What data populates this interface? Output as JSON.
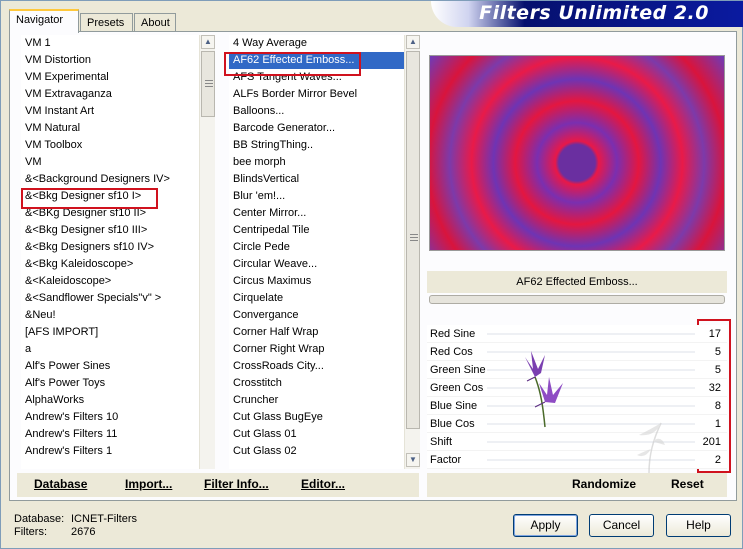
{
  "window": {
    "banner_title": "Filters Unlimited 2.0"
  },
  "tabs": [
    {
      "label": "Navigator"
    },
    {
      "label": "Presets"
    },
    {
      "label": "About"
    }
  ],
  "categories": [
    "VM 1",
    "VM Distortion",
    "VM Experimental",
    "VM Extravaganza",
    "VM Instant Art",
    "VM Natural",
    "VM Toolbox",
    "VM",
    "&<Background Designers IV>",
    "&<Bkg Designer sf10 I>",
    "&<BKg Designer sf10 II>",
    "&<Bkg Designer sf10 III>",
    "&<Bkg Designers sf10 IV>",
    "&<Bkg Kaleidoscope>",
    "&<Kaleidoscope>",
    "&<Sandflower Specials\"v\" >",
    "&Neu!",
    "[AFS IMPORT]",
    "a",
    "Alf's Power Sines",
    "Alf's Power Toys",
    "AlphaWorks",
    "Andrew's Filters 10",
    "Andrew's Filters 11",
    "Andrew's Filters 1"
  ],
  "filters": [
    "4 Way Average",
    "AF62 Effected Emboss...",
    "AFS Tangent Waves...",
    "ALFs Border Mirror Bevel",
    "Balloons...",
    "Barcode Generator...",
    "BB StringThing..",
    "bee morph",
    "BlindsVertical",
    "Blur 'em!...",
    "Center Mirror...",
    "Centripedal Tile",
    "Circle Pede",
    "Circular Weave...",
    "Circus Maximus",
    "Cirquelate",
    "Convergance",
    "Corner Half Wrap",
    "Corner Right Wrap",
    "CrossRoads City...",
    "Crosstitch",
    "Cruncher",
    "Cut Glass  BugEye",
    "Cut Glass 01",
    "Cut Glass 02"
  ],
  "selected_filter_display": "AF62 Effected Emboss...",
  "params": [
    {
      "label": "Red Sine",
      "value": "17"
    },
    {
      "label": "Red Cos",
      "value": "5"
    },
    {
      "label": "Green Sine",
      "value": "5"
    },
    {
      "label": "Green Cos",
      "value": "32"
    },
    {
      "label": "Blue Sine",
      "value": "8"
    },
    {
      "label": "Blue Cos",
      "value": "1"
    },
    {
      "label": "Shift",
      "value": "201"
    },
    {
      "label": "Factor",
      "value": "2"
    }
  ],
  "toolbar": {
    "database": "Database",
    "import": "Import...",
    "filter_info": "Filter Info...",
    "editor": "Editor...",
    "randomize": "Randomize",
    "reset": "Reset"
  },
  "footer": {
    "database_label": "Database:",
    "database_value": "ICNET-Filters",
    "filters_label": "Filters:",
    "filters_value": "2676",
    "apply": "Apply",
    "cancel": "Cancel",
    "help": "Help"
  },
  "colors": {
    "highlight_box": "#d0121e",
    "selection": "#3169c6",
    "banner": "#06106e"
  }
}
